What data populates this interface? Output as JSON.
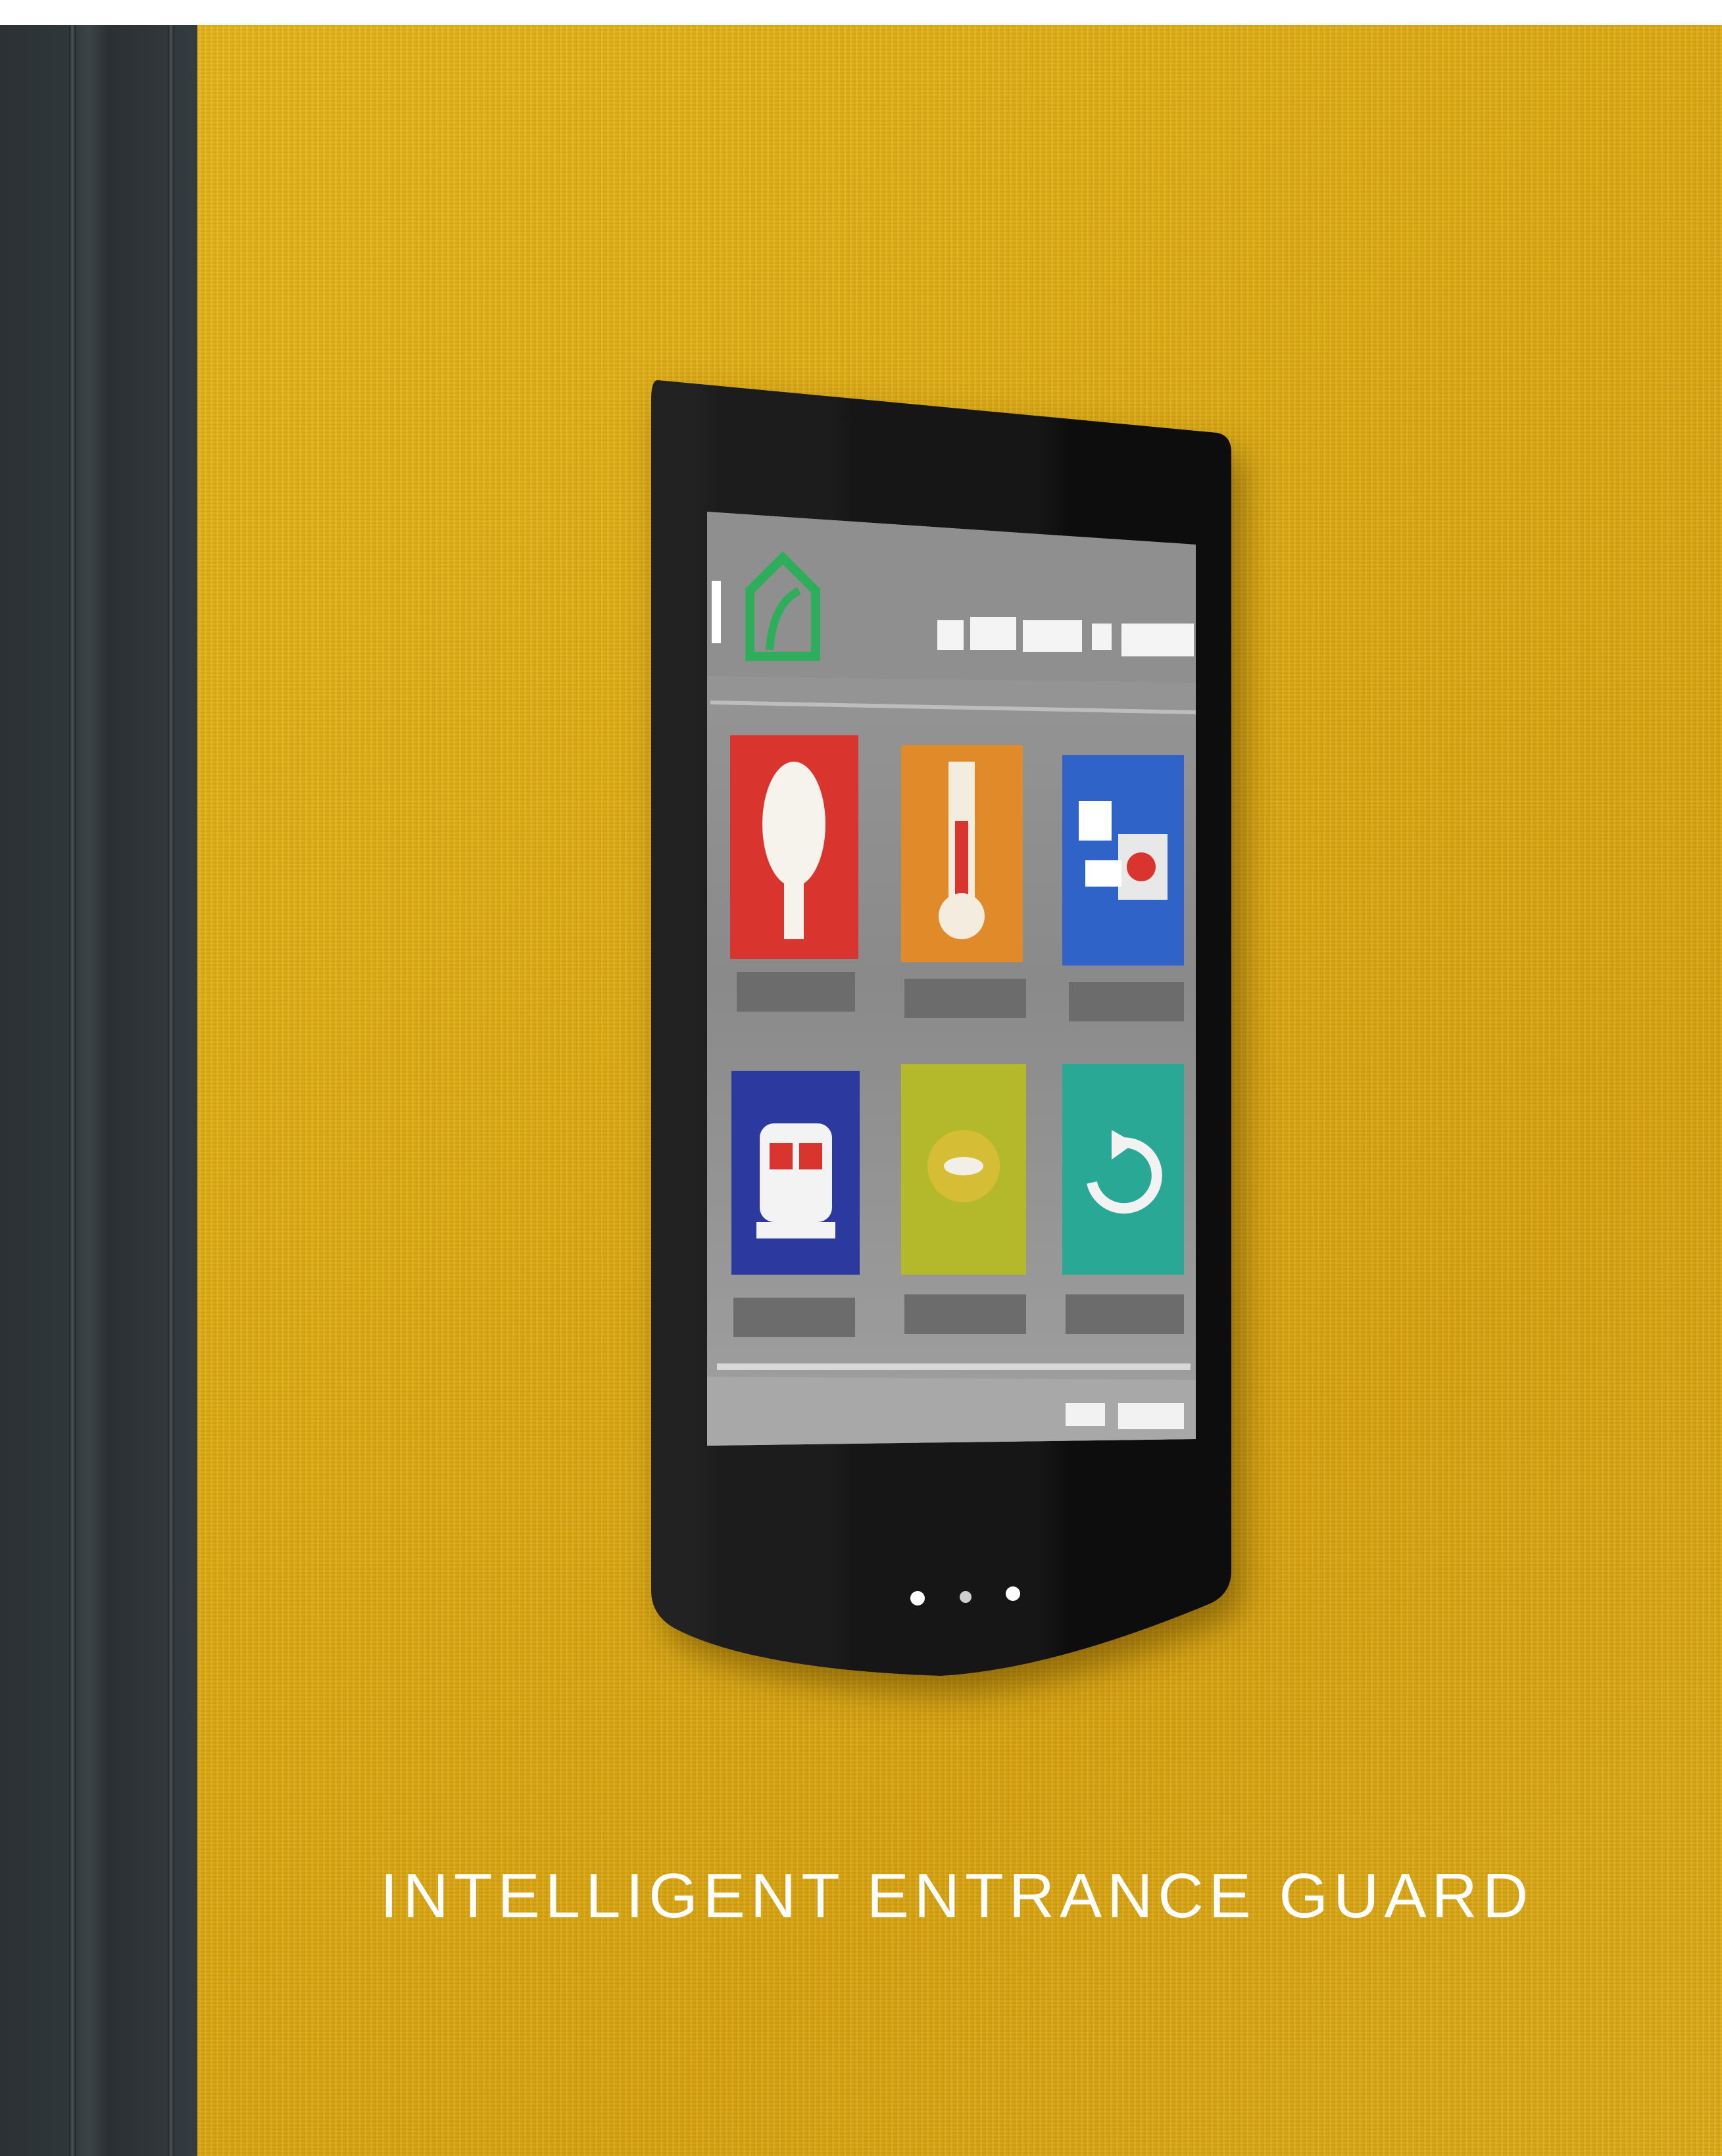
{
  "caption": {
    "title": "INTELLIGENT ENTRANCE GUARD"
  },
  "colors": {
    "wall": "#e0b01c",
    "door_frame": "#2f373a",
    "device_body": "#161616",
    "tile_red": "#d9342e",
    "tile_orange": "#e08a2a",
    "tile_blue": "#2f63c8",
    "tile_navy": "#2c3aa0",
    "tile_lime": "#b4b92c",
    "tile_teal": "#2aa896"
  },
  "device_screen": {
    "logo_icon": "house-leaf-icon",
    "tiles": [
      {
        "icon": "lightbulb-icon",
        "color": "tile_red"
      },
      {
        "icon": "thermometer-icon",
        "color": "tile_orange"
      },
      {
        "icon": "camera-icon",
        "color": "tile_blue"
      },
      {
        "icon": "train-icon",
        "color": "tile_navy"
      },
      {
        "icon": "compass-icon",
        "color": "tile_lime"
      },
      {
        "icon": "refresh-icon",
        "color": "tile_teal"
      }
    ]
  }
}
